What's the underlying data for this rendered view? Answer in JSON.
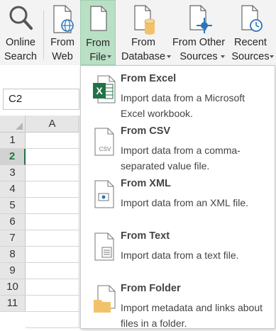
{
  "ribbon": {
    "online_search": "Online Search",
    "from_web": "From Web",
    "from_file": "From File",
    "from_database": "From Database",
    "from_other_sources": "From Other Sources",
    "recent_sources": "Recent Sources"
  },
  "namebox": {
    "value": "C2"
  },
  "grid": {
    "column_a": "A",
    "rows": [
      "1",
      "2",
      "3",
      "4",
      "5",
      "6",
      "7",
      "8",
      "9",
      "10",
      "11"
    ]
  },
  "menu": {
    "items": [
      {
        "title": "From Excel",
        "desc": "Import data from a Microsoft Excel workbook.",
        "icon": "excel-file-icon"
      },
      {
        "title": "From CSV",
        "desc": "Import data from a comma-separated value file.",
        "icon": "csv-file-icon"
      },
      {
        "title": "From XML",
        "desc": "Import data from an XML file.",
        "icon": "xml-file-icon"
      },
      {
        "title": "From Text",
        "desc": "Import data from a text file.",
        "icon": "text-file-icon"
      },
      {
        "title": "From Folder",
        "desc": "Import metadata and links about files in a folder.",
        "icon": "folder-icon"
      }
    ]
  },
  "colors": {
    "accent": "#217346",
    "active_button": "#b9dfc5",
    "icon_blue": "#2e75b6",
    "folder": "#f2c26b"
  }
}
